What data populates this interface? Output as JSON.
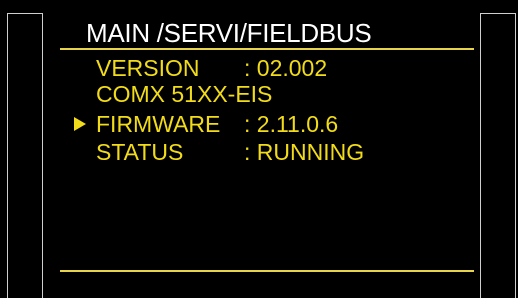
{
  "header": {
    "path": "MAIN /SERVI/FIELDBUS"
  },
  "rows": [
    {
      "label": "VERSION",
      "value": ": 02.002"
    },
    {
      "label": "COMX 51XX-EIS",
      "value": ""
    },
    {
      "label": "FIRMWARE",
      "value": ": 2.11.0.6"
    },
    {
      "label": "STATUS",
      "value": ": RUNNING"
    }
  ],
  "selection": {
    "pointer_icon": "triangle-right-icon",
    "selected_row": 3
  },
  "colors": {
    "background": "#000000",
    "title": "#ffffff",
    "text": "#f2dc19",
    "rule": "#e8d44a",
    "frame": "#cfcfcf"
  }
}
